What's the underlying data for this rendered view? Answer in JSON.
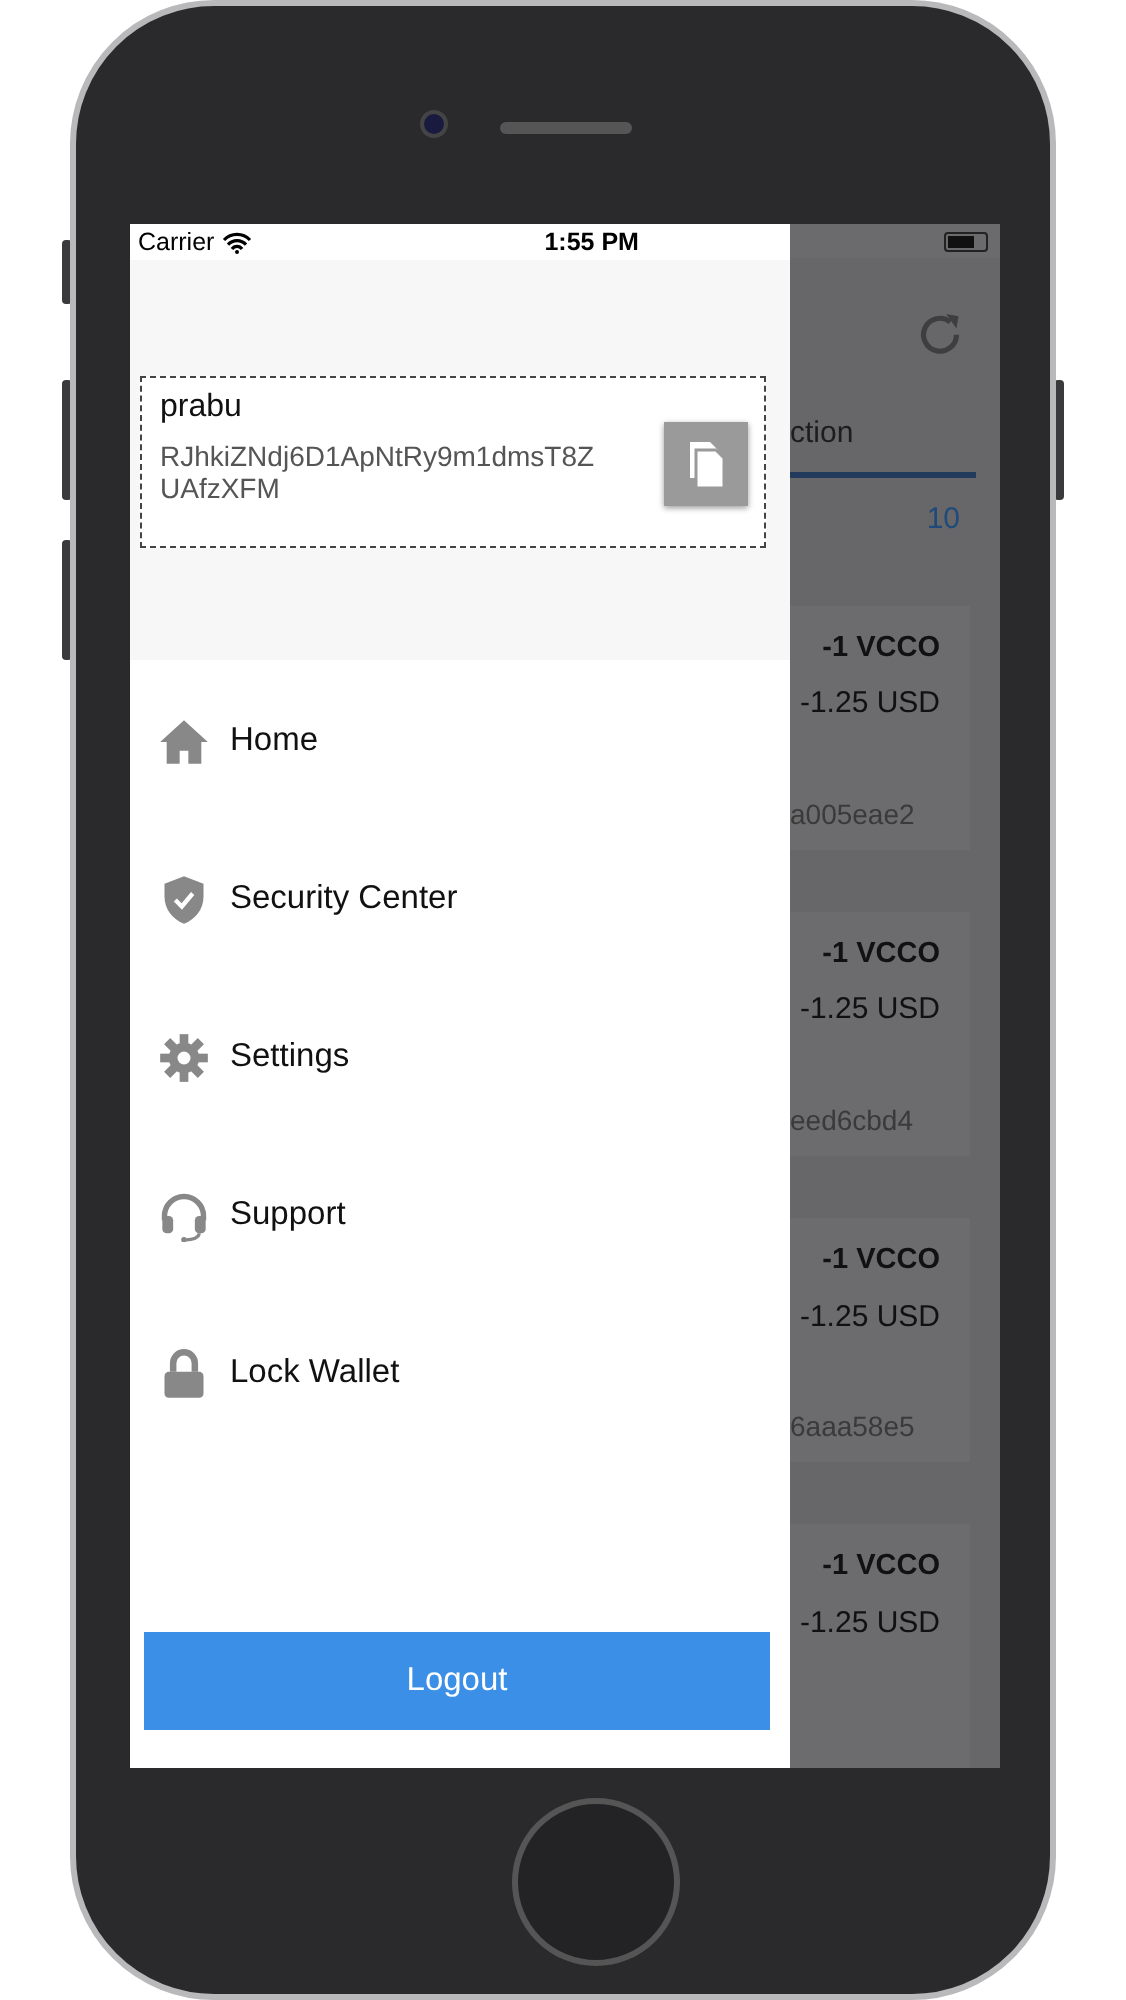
{
  "status_bar": {
    "carrier": "Carrier",
    "time": "1:55 PM"
  },
  "account": {
    "name": "prabu",
    "address": "RJhkiZNdj6D1ApNtRy9m1dmsT8ZUAfzXFM"
  },
  "menu": [
    {
      "label": "Home"
    },
    {
      "label": "Security Center"
    },
    {
      "label": "Settings"
    },
    {
      "label": "Support"
    },
    {
      "label": "Lock Wallet"
    }
  ],
  "logout": "Logout",
  "background": {
    "tab": "ction",
    "count": "10",
    "transactions": [
      {
        "amount": "-1 VCCO",
        "value": "-1.25 USD",
        "hash": "a005eae2"
      },
      {
        "amount": "-1 VCCO",
        "value": "-1.25 USD",
        "hash": "eed6cbd4"
      },
      {
        "amount": "-1 VCCO",
        "value": "-1.25 USD",
        "hash": "6aaa58e5"
      },
      {
        "amount": "-1 VCCO",
        "value": "-1.25 USD"
      }
    ]
  }
}
